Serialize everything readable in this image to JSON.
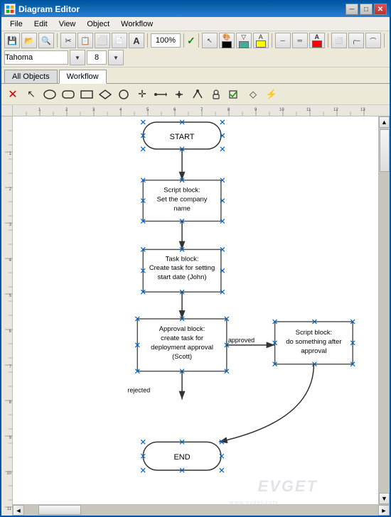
{
  "window": {
    "title": "Diagram Editor",
    "icon": "D"
  },
  "title_buttons": {
    "minimize": "─",
    "restore": "□",
    "close": "✕"
  },
  "menu": {
    "items": [
      "File",
      "Edit",
      "View",
      "Object",
      "Workflow"
    ]
  },
  "toolbar": {
    "zoom_value": "100%",
    "font_name": "Tahoma",
    "font_size": "8",
    "checkmark": "✓"
  },
  "tabs": {
    "all_objects_label": "All Objects",
    "workflow_label": "Workflow"
  },
  "diagram": {
    "start_label": "START",
    "end_label": "END",
    "block1_label": "Script block:\nSet the company\nname",
    "block2_label": "Task block:\nCreate task for setting\nstart date (John)",
    "block3_label": "Approval block:\ncreate task for\ndeployment approval\n(Scott)",
    "block4_label": "Script block:\ndo something after\napproval",
    "arrow1_label": "approved",
    "arrow2_label": "rejected"
  },
  "watermark": "EVGET",
  "scrollbar": {
    "up": "▲",
    "down": "▼",
    "left": "◄",
    "right": "►"
  }
}
